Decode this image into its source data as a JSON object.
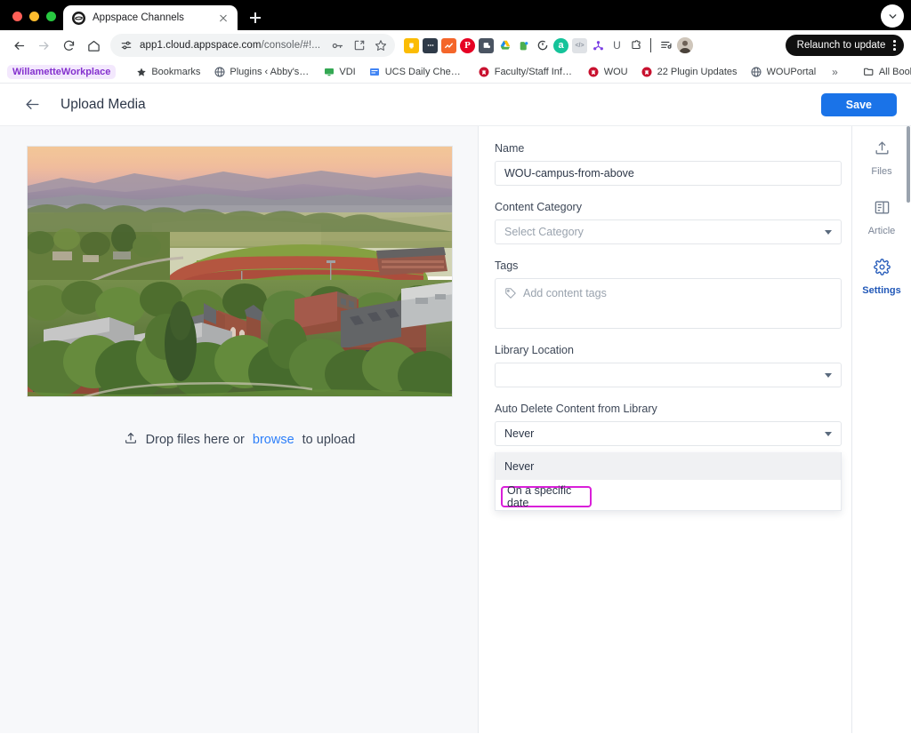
{
  "browser": {
    "tab": {
      "title": "Appspace Channels",
      "favicon": "appspace-logo-icon"
    },
    "omnibox": {
      "url_main": "app1.cloud.appspace.com",
      "url_path": "/console/#!...",
      "site_settings_icon": "tune-icon",
      "password_icon": "key-icon",
      "install_icon": "install-app-icon",
      "bookmark_icon": "star-icon"
    },
    "nav": {
      "back_icon": "arrow-left-icon",
      "forward_icon": "arrow-right-icon",
      "reload_icon": "reload-icon",
      "home_icon": "home-icon"
    },
    "extensions": [
      {
        "name": "ext-yellow-bulb",
        "color": "#fbbc04",
        "glyph": "□"
      },
      {
        "name": "ext-dark-text",
        "color": "#2e3a48",
        "glyph": "…"
      },
      {
        "name": "ext-orange-chart",
        "color": "#f4662a",
        "glyph": "↗"
      },
      {
        "name": "ext-pinterest",
        "color": "#e60023",
        "glyph": "P"
      },
      {
        "name": "ext-gray-badge",
        "color": "#4a5462",
        "glyph": "⚑"
      },
      {
        "name": "ext-google-drive",
        "color": "#ffffff",
        "glyph": "△"
      },
      {
        "name": "ext-evernote",
        "color": "#ffffff",
        "glyph": "⬟"
      },
      {
        "name": "ext-clock-dark",
        "color": "#ffffff",
        "glyph": "◔"
      },
      {
        "name": "ext-grammarly",
        "color": "#15c39a",
        "glyph": "a"
      },
      {
        "name": "ext-code-gray",
        "color": "#dfe2e6",
        "glyph": "</>"
      },
      {
        "name": "ext-purple-network",
        "color": "#ffffff",
        "glyph": "☸"
      },
      {
        "name": "ext-u-letter",
        "color": "#ffffff",
        "glyph": "U"
      },
      {
        "name": "ext-puzzle",
        "color": "#ffffff",
        "glyph": "⬚"
      }
    ],
    "list_icon": "reading-list-icon",
    "profile_icon": "profile-avatar",
    "relaunch_label": "Relaunch to update",
    "menu_icon": "kebab-menu-icon",
    "chevron_icon": "chevron-down-icon",
    "newtab_icon": "new-tab-icon",
    "close_icon": "close-tab-icon",
    "bookmarks": [
      {
        "label": "WillametteWorkplace",
        "style": "pill",
        "icon": ""
      },
      {
        "label": "Bookmarks",
        "icon": "star-icon",
        "color": "#3c4043"
      },
      {
        "label": "Plugins ‹ Abby's H...",
        "icon": "globe-icon",
        "color": "#5f6368"
      },
      {
        "label": "VDI",
        "icon": "monitor-icon",
        "color": "#34a853"
      },
      {
        "label": "UCS Daily Checkin",
        "icon": "form-icon",
        "color": "#4285f4"
      },
      {
        "label": "Faculty/Staff Infor...",
        "icon": "wou-wolf-icon",
        "color": "#c8102e"
      },
      {
        "label": "WOU",
        "icon": "wou-wolf-icon",
        "color": "#c8102e"
      },
      {
        "label": "22 Plugin Updates",
        "icon": "wou-wolf-icon",
        "color": "#c8102e"
      },
      {
        "label": "WOUPortal",
        "icon": "globe-icon",
        "color": "#5f6368"
      }
    ],
    "overflow_label": "»",
    "all_bookmarks_label": "All Bookmarks",
    "all_bookmarks_icon": "folder-icon"
  },
  "app": {
    "back_icon": "arrow-left-icon",
    "page_title": "Upload Media",
    "save_label": "Save",
    "accent_color": "#1a73e8",
    "upload": {
      "icon": "upload-icon",
      "text_before": "Drop files here or",
      "link_label": "browse",
      "text_after": "to upload",
      "image_alt": "WOU campus aerial photo at sunset"
    },
    "form": {
      "name": {
        "label": "Name",
        "value": "WOU-campus-from-above"
      },
      "content_category": {
        "label": "Content Category",
        "value": "",
        "placeholder": "Select Category"
      },
      "tags": {
        "label": "Tags",
        "placeholder": "Add content tags",
        "icon": "tag-icon"
      },
      "library_location": {
        "label": "Library Location",
        "value": ""
      },
      "auto_delete": {
        "label": "Auto Delete Content from Library",
        "value": "Never",
        "options": [
          "Never",
          "On a specific date"
        ],
        "hovered_option": "Never",
        "highlighted_option": "On a specific date",
        "highlight_color": "#d91fd9"
      }
    },
    "rail": [
      {
        "label": "Files",
        "icon": "upload-files-icon",
        "active": false
      },
      {
        "label": "Article",
        "icon": "article-icon",
        "active": false
      },
      {
        "label": "Settings",
        "icon": "gear-icon",
        "active": true
      }
    ]
  }
}
